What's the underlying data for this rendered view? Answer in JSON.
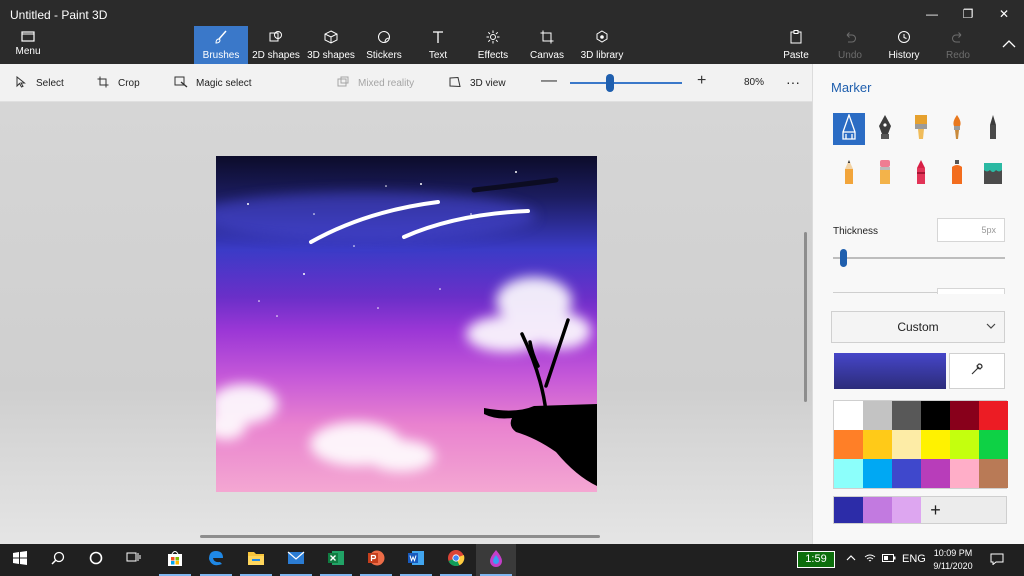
{
  "window": {
    "title": "Untitled - Paint 3D",
    "minimize": "—",
    "maximize": "❐",
    "close": "✕"
  },
  "ribbon": {
    "menu_label": "Menu",
    "tools": [
      {
        "label": "Brushes",
        "icon": "brush-icon"
      },
      {
        "label": "2D shapes",
        "icon": "shapes-2d-icon"
      },
      {
        "label": "3D shapes",
        "icon": "cube-icon"
      },
      {
        "label": "Stickers",
        "icon": "sticker-icon"
      },
      {
        "label": "Text",
        "icon": "text-icon"
      },
      {
        "label": "Effects",
        "icon": "effects-icon"
      },
      {
        "label": "Canvas",
        "icon": "canvas-icon"
      },
      {
        "label": "3D library",
        "icon": "library-icon"
      }
    ],
    "right_tools": [
      {
        "label": "Paste",
        "icon": "paste-icon"
      },
      {
        "label": "Undo",
        "icon": "undo-icon"
      },
      {
        "label": "History",
        "icon": "history-icon"
      },
      {
        "label": "Redo",
        "icon": "redo-icon"
      }
    ]
  },
  "commandbar": {
    "select": "Select",
    "crop": "Crop",
    "magic_select": "Magic select",
    "mixed_reality": "Mixed reality",
    "view_3d": "3D view",
    "zoom_level": 0.36,
    "zoom": "80%",
    "more": "···"
  },
  "panel": {
    "title": "Marker",
    "brushes": [
      "marker-icon",
      "calligraphy-pen-icon",
      "oil-brush-icon",
      "watercolor-icon",
      "pixel-pen-icon",
      "pencil-icon",
      "eraser-icon",
      "crayon-icon",
      "spray-can-icon",
      "fill-bucket-icon"
    ],
    "thickness_label": "Thickness",
    "thickness_value": "5px",
    "thickness_level": 0.06,
    "color_mode": "Custom",
    "current_color": "#4646c8",
    "palette": [
      "#ffffff",
      "#c3c3c3",
      "#585858",
      "#000000",
      "#88001b",
      "#ec1c24",
      "#ff7f27",
      "#ffca18",
      "#fdeca6",
      "#fff200",
      "#c4ff0e",
      "#0ed145",
      "#8cfffb",
      "#00a8f3",
      "#3f48cc",
      "#b83dba",
      "#ffaec8",
      "#b97a56"
    ],
    "recent_colors": [
      "#2c2ca8",
      "#c27ae0",
      "#dda6f0"
    ],
    "add_color": "+"
  },
  "taskbar": {
    "apps": [
      "windows-start-icon",
      "search-icon",
      "cortana-icon",
      "task-view-icon",
      "store-icon",
      "edge-icon",
      "file-explorer-icon",
      "mail-icon",
      "excel-icon",
      "powerpoint-icon",
      "word-icon",
      "chrome-icon",
      "paint3d-icon"
    ],
    "battery": "1:59",
    "lang": "ENG",
    "time": "10:09 PM",
    "date": "9/11/2020"
  }
}
